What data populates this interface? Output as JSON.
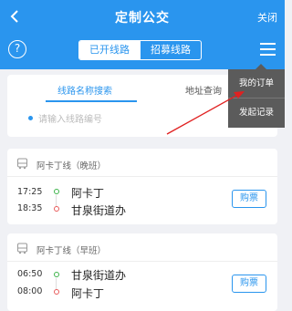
{
  "header": {
    "title": "定制公交",
    "close_label": "关闭",
    "back_icon": "chevron-left-icon"
  },
  "nav": {
    "help_label": "?",
    "tabs": [
      "已开线路",
      "招募线路"
    ],
    "active_tab": "已开线路"
  },
  "search": {
    "tabs": [
      "线路名称搜索",
      "地址查询"
    ],
    "active_tab": "线路名称搜索",
    "placeholder": "请输入线路编号"
  },
  "menu": {
    "items": [
      "我的订单",
      "发起记录"
    ]
  },
  "routes": [
    {
      "title": "阿卡丁线（晚班）",
      "stops": [
        {
          "time": "17:25",
          "name": "阿卡丁"
        },
        {
          "time": "18:35",
          "name": "甘泉街道办"
        }
      ],
      "buy_label": "购票"
    },
    {
      "title": "阿卡丁线（早班）",
      "stops": [
        {
          "time": "06:50",
          "name": "甘泉街道办"
        },
        {
          "time": "08:00",
          "name": "阿卡丁"
        }
      ],
      "buy_label": "购票"
    }
  ],
  "colors": {
    "primary": "#2a95ee",
    "background": "#f0f1f5",
    "menu_bg": "#5b5b5b",
    "origin_dot": "#3db34a",
    "destination_dot": "#e85a5a",
    "annotation_arrow": "#e02020"
  }
}
